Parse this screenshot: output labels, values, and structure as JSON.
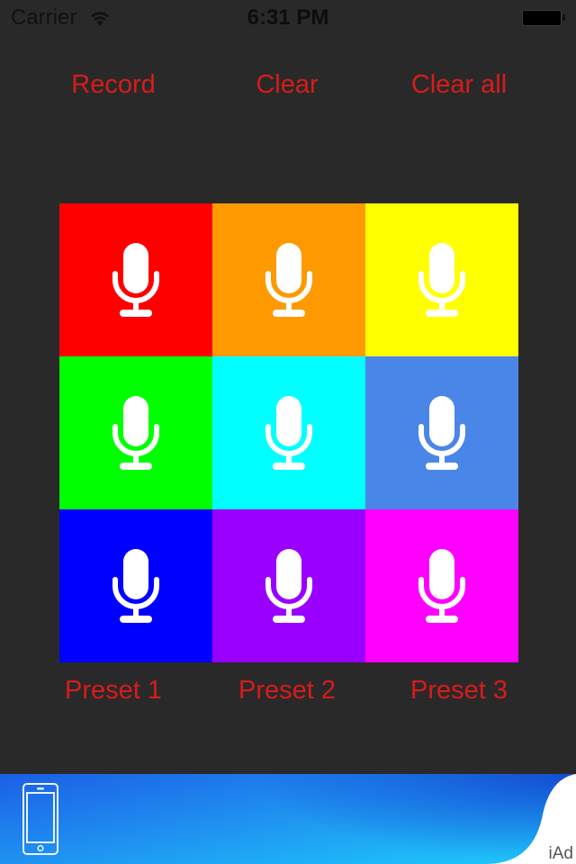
{
  "status_bar": {
    "carrier": "Carrier",
    "time": "6:31 PM",
    "wifi_icon": "wifi-icon",
    "battery_icon": "battery-icon"
  },
  "toolbar": {
    "record_label": "Record",
    "clear_label": "Clear",
    "clear_all_label": "Clear all",
    "text_color": "#d91b1b"
  },
  "pads": [
    {
      "color": "#ff0000",
      "icon": "microphone-icon"
    },
    {
      "color": "#ff9900",
      "icon": "microphone-icon"
    },
    {
      "color": "#ffff00",
      "icon": "microphone-icon"
    },
    {
      "color": "#00ff00",
      "icon": "microphone-icon"
    },
    {
      "color": "#00ffff",
      "icon": "microphone-icon"
    },
    {
      "color": "#4a86e8",
      "icon": "microphone-icon"
    },
    {
      "color": "#0000ff",
      "icon": "microphone-icon"
    },
    {
      "color": "#9900ff",
      "icon": "microphone-icon"
    },
    {
      "color": "#ff00ff",
      "icon": "microphone-icon"
    }
  ],
  "presets": [
    {
      "label": "Preset 1"
    },
    {
      "label": "Preset 2"
    },
    {
      "label": "Preset 3"
    }
  ],
  "ad_banner": {
    "icon": "phone-icon",
    "badge": "iAd"
  }
}
